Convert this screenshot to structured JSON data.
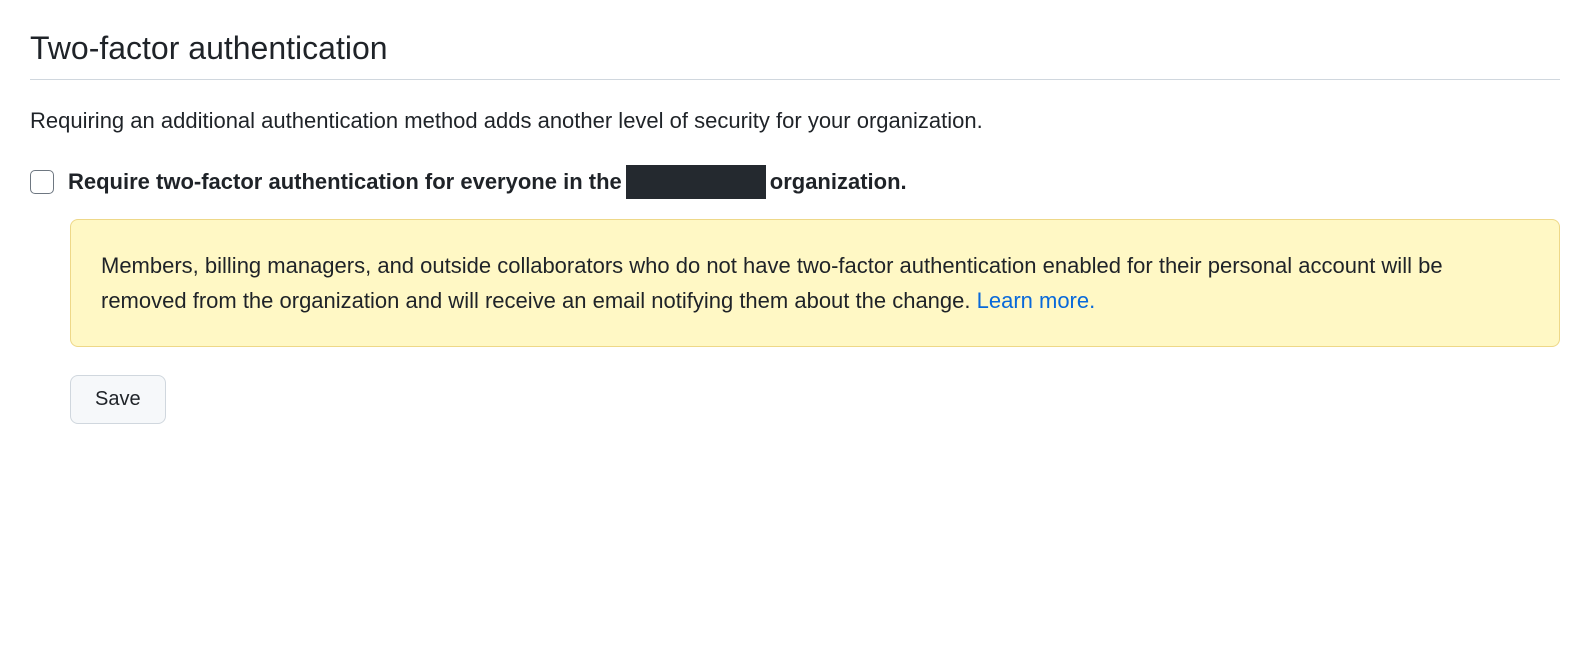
{
  "section": {
    "title": "Two-factor authentication",
    "description": "Requiring an additional authentication method adds another level of security for your organization."
  },
  "checkbox": {
    "label_prefix": "Require two-factor authentication for everyone in the",
    "label_suffix": "organization."
  },
  "warning": {
    "text": "Members, billing managers, and outside collaborators who do not have two-factor authentication enabled for their personal account will be removed from the organization and will receive an email notifying them about the change. ",
    "link_text": "Learn more."
  },
  "buttons": {
    "save": "Save"
  }
}
